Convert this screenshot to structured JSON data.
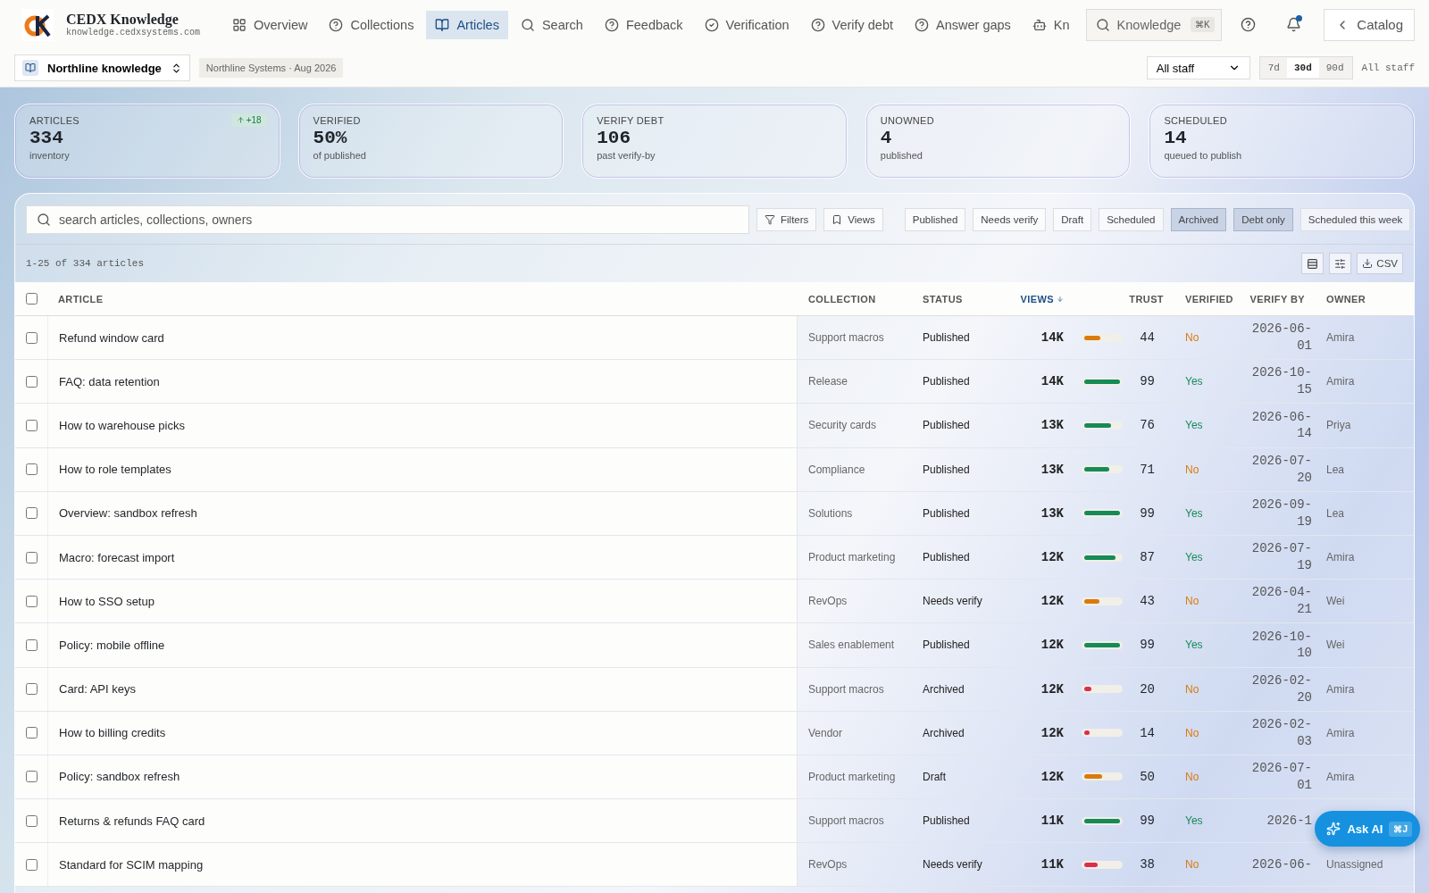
{
  "brand": {
    "name": "CEDX Knowledge",
    "domain": "knowledge.cedxsystems.com"
  },
  "nav": [
    {
      "label": "Overview",
      "selected": false
    },
    {
      "label": "Collections",
      "selected": false
    },
    {
      "label": "Articles",
      "selected": true
    },
    {
      "label": "Search",
      "selected": false
    },
    {
      "label": "Feedback",
      "selected": false
    },
    {
      "label": "Verification",
      "selected": false
    },
    {
      "label": "Verify debt",
      "selected": false
    },
    {
      "label": "Answer gaps",
      "selected": false
    },
    {
      "label": "Kn",
      "selected": false
    }
  ],
  "global_search": {
    "placeholder": "Knowledge",
    "shortcut": "⌘K"
  },
  "notifications": {
    "unread": true
  },
  "back_button": {
    "label": "Catalog"
  },
  "workspace": {
    "label": "Northline knowledge",
    "context": "Northline Systems · Aug 2026"
  },
  "audience_select": {
    "value": "All staff"
  },
  "ranges": [
    {
      "label": "7d",
      "selected": false
    },
    {
      "label": "30d",
      "selected": true
    },
    {
      "label": "90d",
      "selected": false
    }
  ],
  "audience_caption": "All staff",
  "kpis": [
    {
      "label": "ARTICLES",
      "value": "334",
      "caption": "inventory",
      "delta": "+18"
    },
    {
      "label": "VERIFIED",
      "value": "50%",
      "caption": "of published"
    },
    {
      "label": "VERIFY DEBT",
      "value": "106",
      "caption": "past verify-by"
    },
    {
      "label": "UNOWNED",
      "value": "4",
      "caption": "published"
    },
    {
      "label": "SCHEDULED",
      "value": "14",
      "caption": "queued to publish"
    }
  ],
  "search": {
    "placeholder": "search articles, collections, owners"
  },
  "tools": [
    {
      "label": "Filters"
    },
    {
      "label": "Views"
    }
  ],
  "chips": [
    {
      "label": "Published",
      "selected": false
    },
    {
      "label": "Needs verify",
      "selected": false
    },
    {
      "label": "Draft",
      "selected": false
    },
    {
      "label": "Scheduled",
      "selected": false
    },
    {
      "label": "Archived",
      "selected": true
    },
    {
      "label": "Debt only",
      "selected": true
    },
    {
      "label": "Scheduled this week",
      "selected": false
    }
  ],
  "result_count": "1-25 of 334 articles",
  "export_label": "CSV",
  "table": {
    "select_all": {
      "checked": false
    },
    "columns": [
      {
        "label": "ARTICLE",
        "sorted": false
      },
      {
        "label": "COLLECTION",
        "sorted": false
      },
      {
        "label": "STATUS",
        "sorted": false
      },
      {
        "label": "VIEWS",
        "sorted": true
      },
      {
        "label": "TRUST",
        "sorted": false
      },
      {
        "label": "VERIFIED",
        "sorted": false
      },
      {
        "label": "VERIFY BY",
        "sorted": false
      },
      {
        "label": "OWNER",
        "sorted": false
      }
    ],
    "rows": [
      {
        "checked": false,
        "article": "Refund window card",
        "collection": "Support macros",
        "status": "Published",
        "views": "14K",
        "trust": "44",
        "level": 0.44,
        "verified": {
          "label": "No",
          "ok": false
        },
        "verify_by": "2026-06-01",
        "owner": "Amira"
      },
      {
        "checked": false,
        "article": "FAQ: data retention",
        "collection": "Release",
        "status": "Published",
        "views": "14K",
        "trust": "99",
        "level": 0.99,
        "verified": {
          "label": "Yes",
          "ok": true
        },
        "verify_by": "2026-10-15",
        "owner": "Amira"
      },
      {
        "checked": false,
        "article": "How to warehouse picks",
        "collection": "Security cards",
        "status": "Published",
        "views": "13K",
        "trust": "76",
        "level": 0.76,
        "verified": {
          "label": "Yes",
          "ok": true
        },
        "verify_by": "2026-06-14",
        "owner": "Priya"
      },
      {
        "checked": false,
        "article": "How to role templates",
        "collection": "Compliance",
        "status": "Published",
        "views": "13K",
        "trust": "71",
        "level": 0.71,
        "verified": {
          "label": "No",
          "ok": false
        },
        "verify_by": "2026-07-20",
        "owner": "Lea"
      },
      {
        "checked": false,
        "article": "Overview: sandbox refresh",
        "collection": "Solutions",
        "status": "Published",
        "views": "13K",
        "trust": "99",
        "level": 0.99,
        "verified": {
          "label": "Yes",
          "ok": true
        },
        "verify_by": "2026-09-19",
        "owner": "Lea"
      },
      {
        "checked": false,
        "article": "Macro: forecast import",
        "collection": "Product marketing",
        "status": "Published",
        "views": "12K",
        "trust": "87",
        "level": 0.87,
        "verified": {
          "label": "Yes",
          "ok": true
        },
        "verify_by": "2026-07-19",
        "owner": "Amira"
      },
      {
        "checked": false,
        "article": "How to SSO setup",
        "collection": "RevOps",
        "status": "Needs verify",
        "views": "12K",
        "trust": "43",
        "level": 0.43,
        "verified": {
          "label": "No",
          "ok": false
        },
        "verify_by": "2026-04-21",
        "owner": "Wei"
      },
      {
        "checked": false,
        "article": "Policy: mobile offline",
        "collection": "Sales enablement",
        "status": "Published",
        "views": "12K",
        "trust": "99",
        "level": 0.99,
        "verified": {
          "label": "Yes",
          "ok": true
        },
        "verify_by": "2026-10-10",
        "owner": "Wei"
      },
      {
        "checked": false,
        "article": "Card: API keys",
        "collection": "Support macros",
        "status": "Archived",
        "views": "12K",
        "trust": "20",
        "level": 0.2,
        "verified": {
          "label": "No",
          "ok": false
        },
        "verify_by": "2026-02-20",
        "owner": "Amira"
      },
      {
        "checked": false,
        "article": "How to billing credits",
        "collection": "Vendor",
        "status": "Archived",
        "views": "12K",
        "trust": "14",
        "level": 0.14,
        "verified": {
          "label": "No",
          "ok": false
        },
        "verify_by": "2026-02-03",
        "owner": "Amira"
      },
      {
        "checked": false,
        "article": "Policy: sandbox refresh",
        "collection": "Product marketing",
        "status": "Draft",
        "views": "12K",
        "trust": "50",
        "level": 0.5,
        "verified": {
          "label": "No",
          "ok": false
        },
        "verify_by": "2026-07-01",
        "owner": "Amira"
      },
      {
        "checked": false,
        "article": "Returns & refunds FAQ card",
        "collection": "Support macros",
        "status": "Published",
        "views": "11K",
        "trust": "99",
        "level": 0.99,
        "verified": {
          "label": "Yes",
          "ok": true
        },
        "verify_by": "2026-1"
      },
      {
        "checked": false,
        "article": "Standard for SCIM mapping",
        "collection": "RevOps",
        "status": "Needs verify",
        "views": "11K",
        "trust": "38",
        "level": 0.38,
        "verified": {
          "label": "No",
          "ok": false
        },
        "verify_by": "2026-06-",
        "owner": "Unassigned"
      }
    ]
  },
  "assistant": {
    "label": "Ask AI",
    "shortcut": "⌘J"
  }
}
